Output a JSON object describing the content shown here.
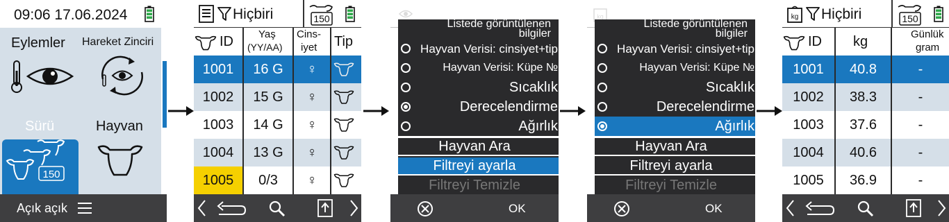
{
  "colors": {
    "accent": "#1a78bf",
    "dark": "#3e3e40",
    "highlight_yellow": "#f5d000",
    "alt_row": "#d5dfe8",
    "battery": "#2ea84a"
  },
  "screen1": {
    "datetime": "09:06 17.06.2024",
    "tiles": [
      "Eylemler",
      "Hareket Zinciri",
      "Sürü",
      "Hayvan"
    ],
    "herd_count": "150",
    "footer_label": "Açık açık"
  },
  "screen2": {
    "filter_label": "Hiçbiri",
    "count": "150",
    "headers": {
      "id": "ID",
      "age": "Yaş",
      "age_unit": "(YY/AA)",
      "sex": "Cins-",
      "sex2": "iyet",
      "type": "Tip"
    },
    "rows": [
      {
        "id": "1001",
        "age": "16 G",
        "sex": "♀"
      },
      {
        "id": "1002",
        "age": "15 G",
        "sex": "♀"
      },
      {
        "id": "1003",
        "age": "14 G",
        "sex": "♀"
      },
      {
        "id": "1004",
        "age": "13 G",
        "sex": "♀"
      },
      {
        "id": "1005",
        "age": "0/3",
        "sex": "♀"
      }
    ]
  },
  "menu": {
    "title_line1": "Listede görüntülenen",
    "title_line2": "bilgiler",
    "options": [
      "Hayvan Verisi: cinsiyet+tip",
      "Hayvan Verisi: Küpe №",
      "Sıcaklık",
      "Derecelendirme",
      "Ağırlık"
    ],
    "actions": [
      "Hayvan Ara",
      "Filtreyi ayarla",
      "Filtreyi Temizle"
    ],
    "ok_label": "OK"
  },
  "screen5": {
    "filter_label": "Hiçbiri",
    "count": "150",
    "headers": {
      "id": "ID",
      "kg": "kg",
      "daily1": "Günlük",
      "daily2": "gram"
    },
    "rows": [
      {
        "id": "1001",
        "kg": "40.8",
        "daily": "-"
      },
      {
        "id": "1002",
        "kg": "38.3",
        "daily": "-"
      },
      {
        "id": "1003",
        "kg": "37.6",
        "daily": "-"
      },
      {
        "id": "1004",
        "kg": "40.6",
        "daily": "-"
      },
      {
        "id": "1005",
        "kg": "36.9",
        "daily": "-"
      }
    ]
  }
}
